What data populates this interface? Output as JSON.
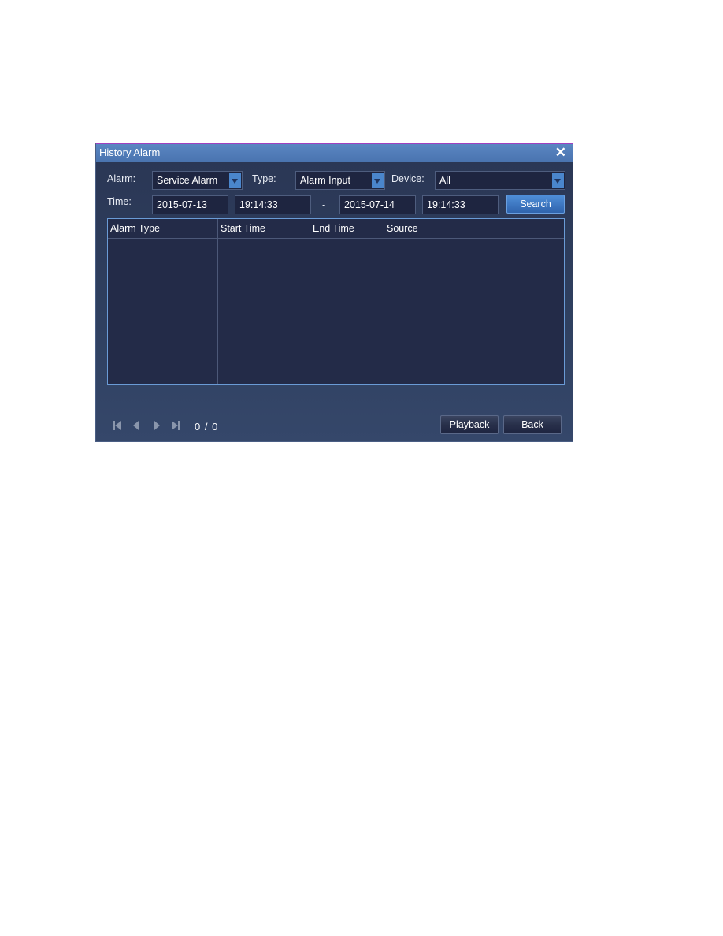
{
  "dialog": {
    "title": "History Alarm",
    "close_icon": "close-icon"
  },
  "filters": {
    "alarm_label": "Alarm:",
    "alarm_value": "Service Alarm",
    "type_label": "Type:",
    "type_value": "Alarm Input",
    "device_label": "Device:",
    "device_value": "All",
    "time_label": "Time:",
    "start_date": "2015-07-13",
    "start_time": "19:14:33",
    "separator": "-",
    "end_date": "2015-07-14",
    "end_time": "19:14:33",
    "search_label": "Search"
  },
  "table": {
    "columns": [
      "Alarm Type",
      "Start Time",
      "End Time",
      "Source"
    ],
    "rows": []
  },
  "pagination": {
    "current": 0,
    "total": 0,
    "text": "0 / 0"
  },
  "buttons": {
    "playback": "Playback",
    "back": "Back"
  },
  "colors": {
    "accent": "#4a86cc",
    "titlebar": "#5080bc",
    "panel": "#2f3f5e"
  }
}
